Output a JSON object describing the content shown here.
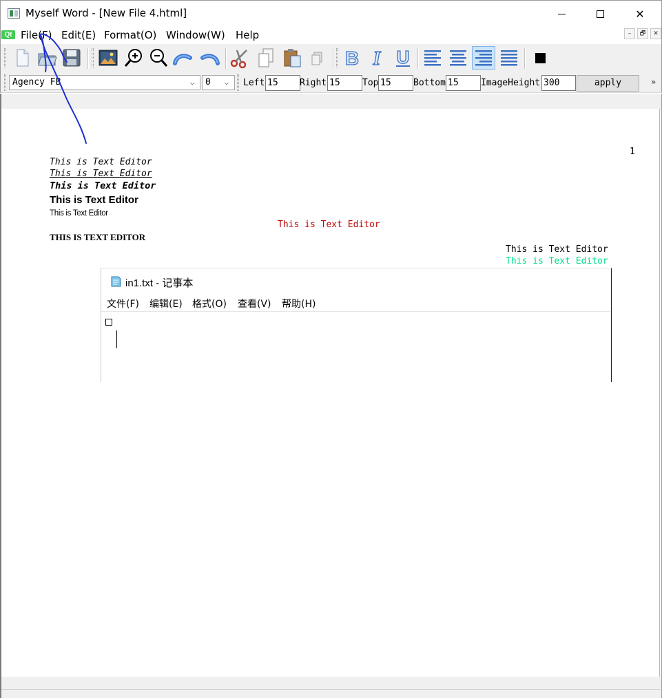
{
  "window": {
    "title": "Myself Word - [New File 4.html]",
    "minimize_icon": "minimize-icon",
    "maximize_icon": "maximize-icon",
    "close_icon": "close-icon",
    "close_glyph": "✕"
  },
  "menubar": {
    "qt_logo": "Qt",
    "items": [
      "File(F)",
      "Edit(E)",
      "Format(O)",
      "Window(W)",
      "Help"
    ],
    "mdi_buttons": [
      "–",
      "🗗",
      "✕"
    ]
  },
  "toolbar": {
    "buttons": [
      "new-file-icon",
      "open-file-icon",
      "save-icon",
      "insert-image-icon",
      "zoom-in-icon",
      "zoom-out-icon",
      "undo-icon",
      "redo-icon",
      "cut-icon",
      "copy-icon",
      "paste-icon",
      "paste-special-icon",
      "bold-icon",
      "italic-icon",
      "underline-icon",
      "align-left-icon",
      "align-center-icon",
      "align-right-icon",
      "justify-icon",
      "text-color-icon"
    ],
    "active_button": "align-right-icon",
    "text_color": "#000000",
    "bold_glyph": "B",
    "italic_glyph": "I",
    "underline_glyph": "U"
  },
  "formatbar": {
    "font_family": "Agency FB",
    "font_size": "0",
    "chevron": "⌵",
    "left_label": "Left",
    "left_value": "15",
    "right_label": "Right",
    "right_value": "15",
    "top_label": "Top",
    "top_value": "15",
    "bottom_label": "Bottom",
    "bottom_value": "15",
    "image_height_label": "ImageHeight",
    "image_height_value": "300",
    "apply_label": "apply",
    "overflow": "»"
  },
  "document": {
    "page_number": "1",
    "lines": [
      "This is Text Editor",
      "This is Text Editor",
      "This is Text Editor",
      "This is Text Editor",
      "This is Text Editor",
      "This is Text Editor",
      "THIS IS TEXT EDITOR",
      "This is Text Editor",
      "This is Text Editor"
    ],
    "colors": {
      "red_line": "#c00000",
      "green_line": "#00e08a"
    }
  },
  "notepad": {
    "title": "in1.txt - 记事本",
    "menu": [
      "文件(F)",
      "编辑(E)",
      "格式(O)",
      "查看(V)",
      "帮助(H)"
    ],
    "content_glyph": "□"
  },
  "annotation": {
    "color": "#1e2fd6"
  }
}
